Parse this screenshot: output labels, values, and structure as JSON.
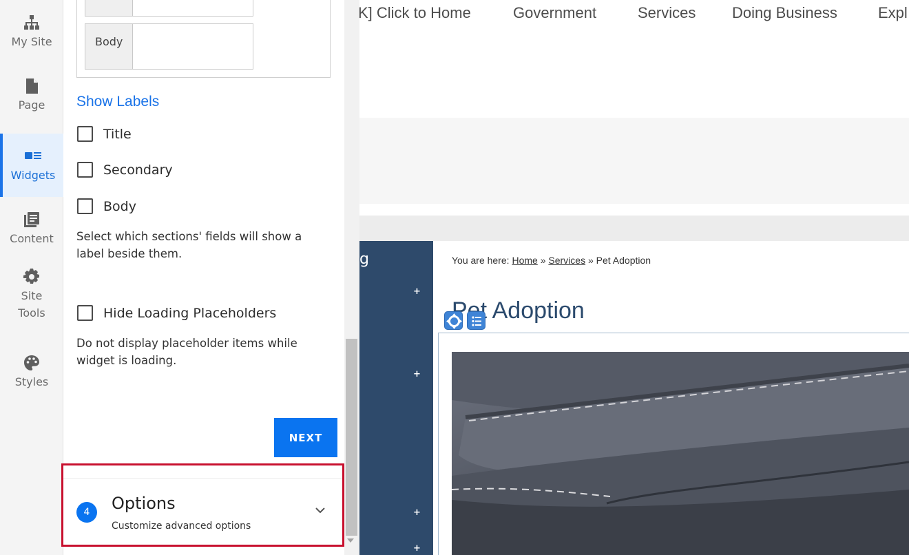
{
  "rail": {
    "items": [
      {
        "label": "My Site",
        "icon": "sitemap-icon"
      },
      {
        "label": "Page",
        "icon": "page-icon"
      },
      {
        "label": "Widgets",
        "icon": "widgets-icon",
        "active": true
      },
      {
        "label": "Content",
        "icon": "content-icon"
      },
      {
        "label_line1": "Site",
        "label_line2": "Tools",
        "icon": "gear-icon"
      },
      {
        "label": "Styles",
        "icon": "palette-icon"
      }
    ]
  },
  "panel": {
    "field_label": "Body",
    "show_labels_heading": "Show Labels",
    "checkboxes": [
      {
        "label": "Title",
        "checked": false
      },
      {
        "label": "Secondary",
        "checked": false
      },
      {
        "label": "Body",
        "checked": false
      }
    ],
    "show_labels_help": "Select which sections' fields will show a label beside them.",
    "hide_placeholders": {
      "label": "Hide Loading Placeholders",
      "checked": false
    },
    "hide_placeholders_help": "Do not display placeholder items while widget is loading.",
    "next_label": "NEXT",
    "options_step": {
      "number": "4",
      "title": "Options",
      "subtitle": "Customize advanced options"
    }
  },
  "site": {
    "nav": [
      "K] Click to Home",
      "Government",
      "Services",
      "Doing Business",
      "Expl"
    ],
    "side_text": "g",
    "plus": "+",
    "breadcrumb": {
      "prefix": "You are here:",
      "home": "Home",
      "sep": "»",
      "services": " Services",
      "current": "Pet Adoption"
    },
    "page_title": "Pet Adoption"
  },
  "colors": {
    "accent": "#1a73e8",
    "button": "#0a74f0",
    "highlight": "#c8102e",
    "sidenav": "#2e4a6b"
  }
}
